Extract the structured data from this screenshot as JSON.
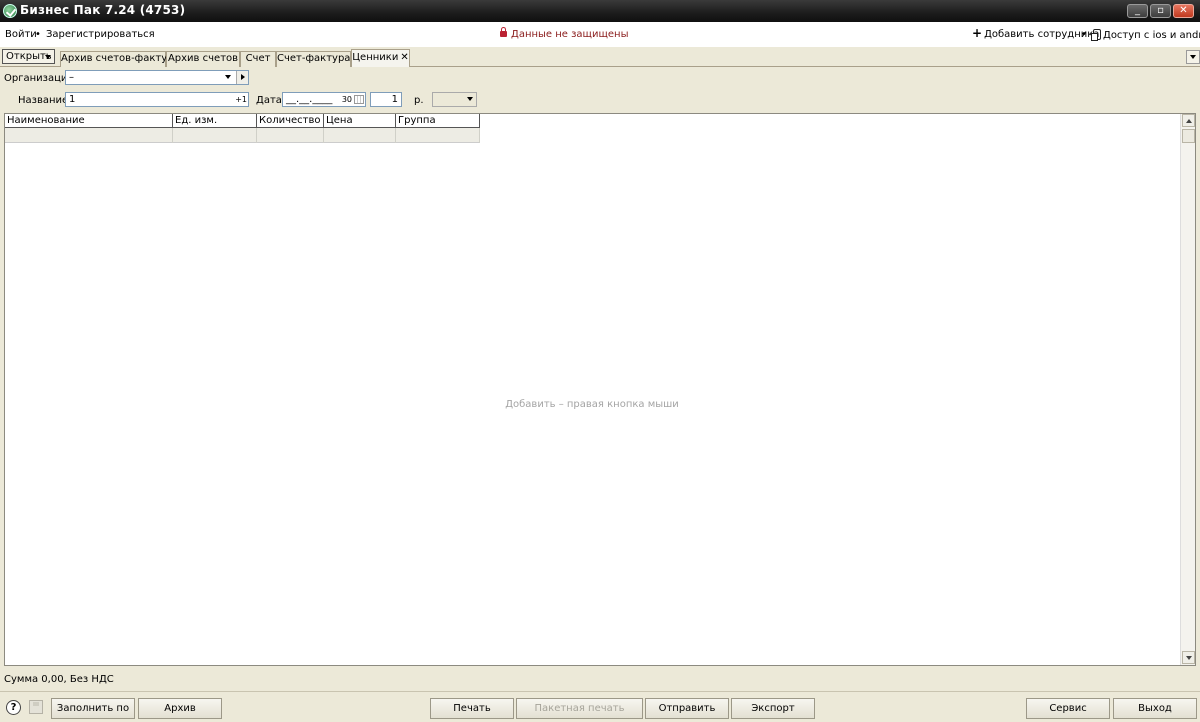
{
  "window": {
    "title": "Бизнес Пак 7.24 (4753)",
    "controls": {
      "minimize": "_",
      "restore": "▫",
      "close": "✕"
    }
  },
  "menubar": {
    "login": "Войти",
    "separator": "•",
    "register": "Зарегистрироваться",
    "warning": "Данные не защищены",
    "add_employee": "Добавить сотрудника",
    "mobile_access": "Доступ с ios и android"
  },
  "toolbar": {
    "open_label": "Открыть",
    "tabs": [
      {
        "label": "Архив счетов-фактур"
      },
      {
        "label": "Архив счетов"
      },
      {
        "label": "Счет"
      },
      {
        "label": "Счет-фактура"
      },
      {
        "label": "Ценники",
        "active": true,
        "close_glyph": "✕"
      }
    ]
  },
  "form": {
    "organization_label": "Организация",
    "organization_value": "–",
    "name_label": "Название",
    "name_value": "1",
    "increment_label": "+1",
    "date_label": "Дата",
    "date_value": "__.__.____",
    "calendar_day": "30",
    "quantity_value": "1",
    "currency_label": "р.",
    "currency_value": ""
  },
  "grid": {
    "columns": [
      "Наименование",
      "Ед. изм.",
      "Количество",
      "Цена",
      "Группа"
    ],
    "rows": [
      [
        "",
        "",
        "",
        "",
        ""
      ]
    ],
    "empty_hint": "Добавить – правая кнопка мыши"
  },
  "status": {
    "summary": "Сумма 0,00, Без НДС"
  },
  "bottom": {
    "help_glyph": "?",
    "fill_label": "Заполнить по",
    "archive_label": "Архив",
    "print_label": "Печать",
    "batch_print_label": "Пакетная печать",
    "send_label": "Отправить",
    "export_label": "Экспорт",
    "service_label": "Сервис",
    "exit_label": "Выход"
  },
  "colors": {
    "titlebar": "#1c1c1c",
    "panel": "#ece9d8",
    "warning_text": "#8a1b1b",
    "hint_text": "#a4a4a4",
    "close_button": "#c0391f"
  }
}
